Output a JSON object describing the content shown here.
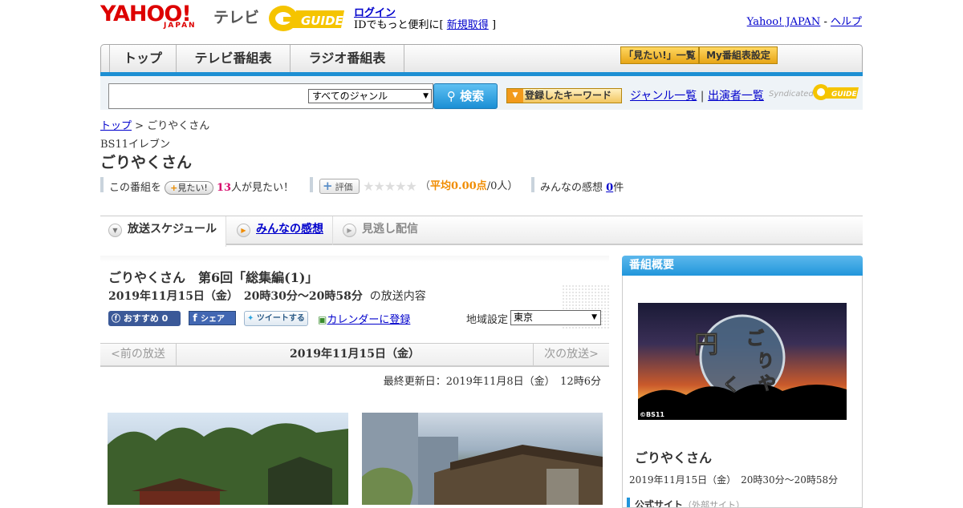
{
  "header": {
    "logo_yahoo": "YAHOO!",
    "logo_japan": "JAPAN",
    "logo_tv": "テレビ",
    "login_label": "ログイン",
    "login_desc_prefix": "IDでもっと便利に[",
    "register_label": "新規取得",
    "login_desc_suffix": "]",
    "yahoo_japan_link": "Yahoo! JAPAN",
    "separator": "-",
    "help_link": "ヘルプ"
  },
  "nav": {
    "tabs": [
      "トップ",
      "テレビ番組表",
      "ラジオ番組表"
    ],
    "want_list_button": "「見たい!」一覧",
    "my_guide_button": "My番組表設定"
  },
  "search": {
    "genre_selected": "すべてのジャンル",
    "search_button": "検索",
    "keyword_button": "登録したキーワード",
    "genre_list_link": "ジャンル一覧",
    "divider": "|",
    "performer_list_link": "出演者一覧",
    "syndicated": "Syndicated"
  },
  "breadcrumb": {
    "home": "トップ",
    "sep": ">",
    "current": "ごりやくさん"
  },
  "program": {
    "channel": "BS11イレブン",
    "title": "ごりやくさん",
    "want_prefix": "この番組を",
    "want_button": "見たい!",
    "want_count": "13",
    "want_suffix": "人が見たい！",
    "rate_button": "評価",
    "stars": "★★★★★",
    "avg_open": "（",
    "avg_label": "平均0.00点",
    "avg_people": "/0人）",
    "impressions_label": "みんなの感想",
    "impressions_count": "0",
    "impressions_unit": "件"
  },
  "content_tabs": {
    "schedule": "放送スケジュール",
    "impressions": "みんなの感想",
    "streaming": "見逃し配信"
  },
  "episode": {
    "title": "ごりやくさん　第6回「総集編(1)」",
    "datetime": "2019年11月15日（金）　20時30分～20時58分",
    "datetime_suffix": "の放送内容",
    "fb_recommend": "おすすめ 0",
    "fb_share": "シェア",
    "tweet": "ツイートする",
    "calendar": "カレンダーに登録",
    "region_label": "地域設定",
    "region_selected": "東京",
    "prev": "<前の放送",
    "current_date": "2019年11月15日（金）",
    "next": "次の放送>",
    "last_updated": "最終更新日：2019年11月8日（金）　12時6分"
  },
  "sidebar": {
    "header": "番組概要",
    "image_credit": "©BS11",
    "title": "ごりやくさん",
    "datetime": "2019年11月15日（金）　20時30分～20時58分",
    "official_site": "公式サイト",
    "official_site_note": "（外部サイト）"
  },
  "colors": {
    "accent_blue": "#1d8fd3",
    "yahoo_red": "#dd0000",
    "link": "#0000cc",
    "pink_count": "#d60c6d",
    "orange_rating": "#f08c00"
  }
}
